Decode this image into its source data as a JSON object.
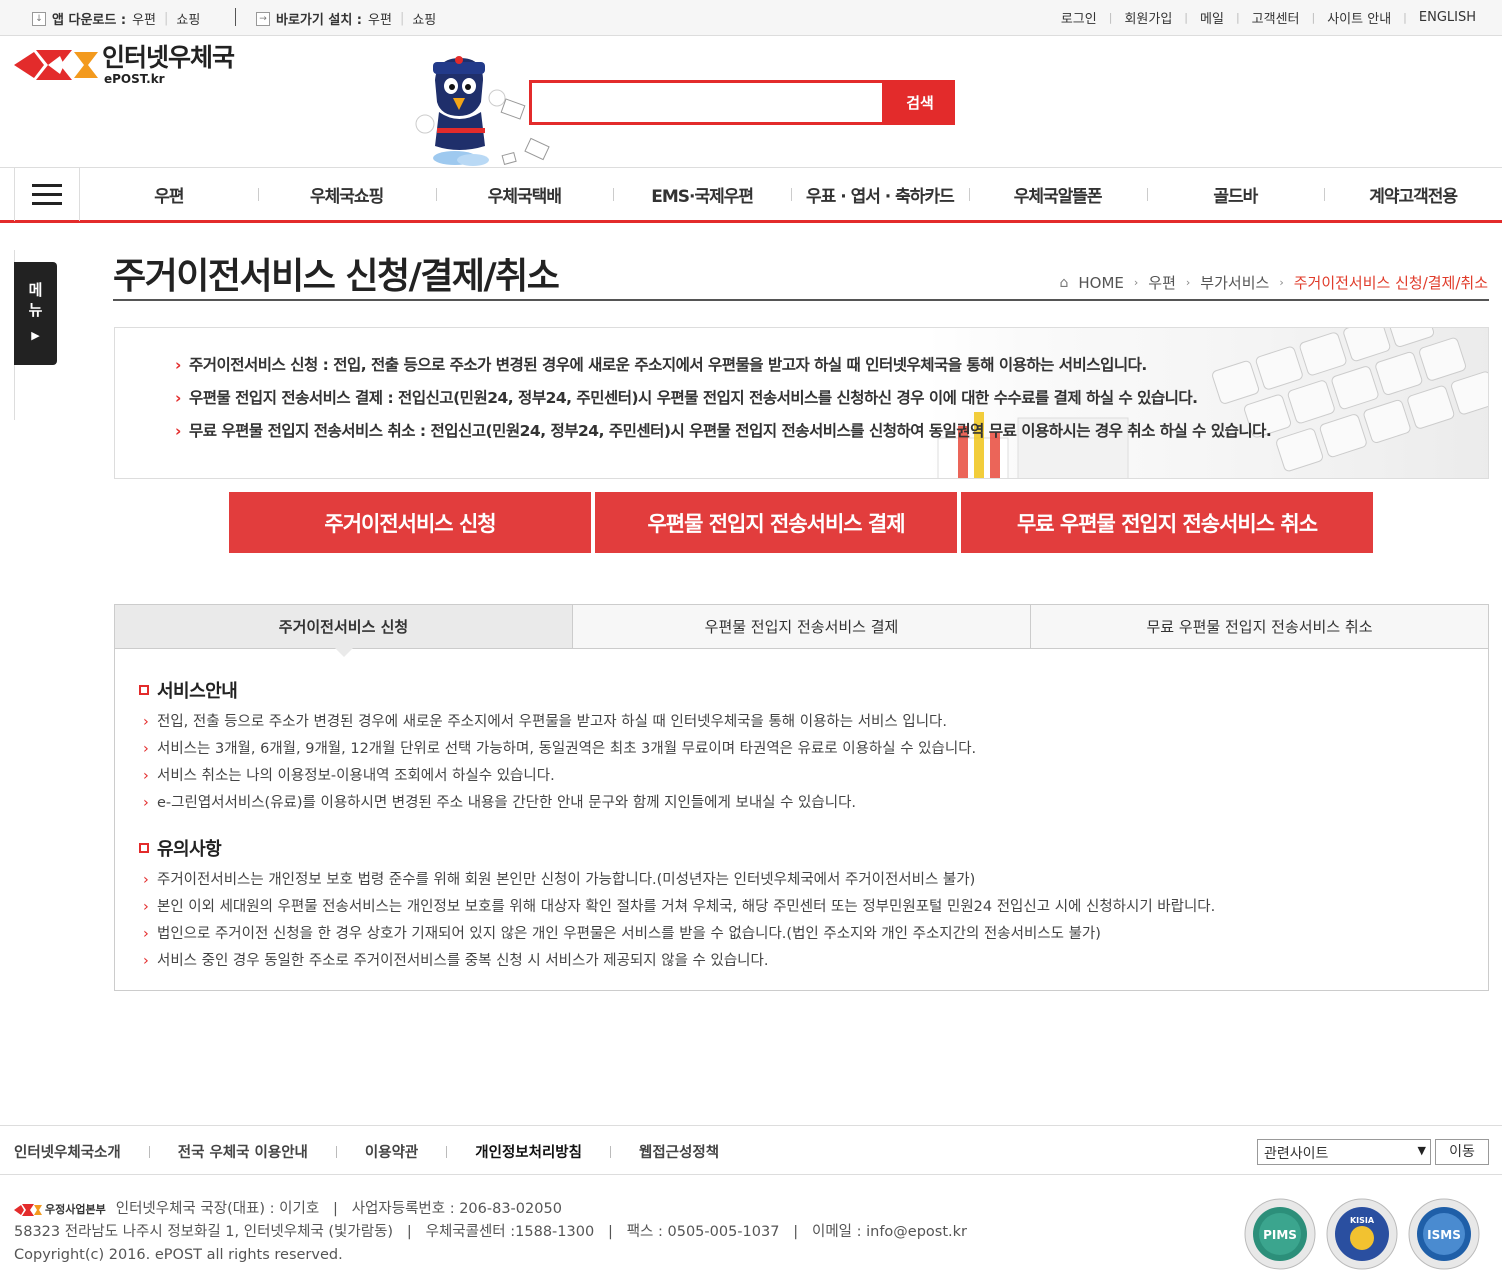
{
  "topbar": {
    "app_download_label": "앱 다운로드 :",
    "app_links": [
      "우편",
      "쇼핑"
    ],
    "shortcut_label": "바로가기 설치 :",
    "shortcut_links": [
      "우편",
      "쇼핑"
    ],
    "right_links": [
      "로그인",
      "회원가입",
      "메일",
      "고객센터",
      "사이트 안내",
      "ENGLISH"
    ]
  },
  "header": {
    "logo_korean": "인터넷우체국",
    "logo_english": "ePOST.kr",
    "search_placeholder": "",
    "search_button": "검색"
  },
  "gnb": {
    "items": [
      "우편",
      "우체국쇼핑",
      "우체국택배",
      "EMS·국제우편",
      "우표 · 엽서 · 축하카드",
      "우체국알뜰폰",
      "골드바",
      "계약고객전용"
    ]
  },
  "side_menu": {
    "label": "메뉴"
  },
  "page": {
    "title": "주거이전서비스 신청/결제/취소",
    "breadcrumb": [
      "HOME",
      "우편",
      "부가서비스",
      "주거이전서비스 신청/결제/취소"
    ]
  },
  "intro": {
    "items": [
      "주거이전서비스 신청 : 전입, 전출 등으로 주소가 변경된 경우에 새로운 주소지에서 우편물을 받고자 하실 때 인터넷우체국을 통해 이용하는 서비스입니다.",
      "우편물 전입지 전송서비스 결제 : 전입신고(민원24, 정부24, 주민센터)시 우편물 전입지 전송서비스를 신청하신 경우 이에 대한 수수료를 결제 하실 수 있습니다.",
      "무료 우편물 전입지 전송서비스 취소 : 전입신고(민원24, 정부24, 주민센터)시 우편물 전입지 전송서비스를 신청하여 동일권역 무료 이용하시는 경우 취소 하실 수 있습니다."
    ]
  },
  "big_buttons": [
    "주거이전서비스 신청",
    "우편물 전입지 전송서비스 결제",
    "무료 우편물 전입지 전송서비스 취소"
  ],
  "tabs": [
    "주거이전서비스 신청",
    "우편물 전입지 전송서비스 결제",
    "무료 우편물 전입지 전송서비스 취소"
  ],
  "service_guide": {
    "heading": "서비스안내",
    "items": [
      "전입, 전출 등으로 주소가 변경된 경우에 새로운 주소지에서 우편물을 받고자 하실 때 인터넷우체국을 통해 이용하는 서비스 입니다.",
      "서비스는 3개월, 6개월, 9개월, 12개월 단위로 선택 가능하며, 동일권역은 최초 3개월 무료이며 타권역은 유료로 이용하실 수 있습니다.",
      "서비스 취소는 나의 이용정보-이용내역 조회에서 하실수 있습니다.",
      "e-그린엽서서비스(유료)를 이용하시면 변경된 주소 내용을 간단한 안내 문구와 함께 지인들에게 보내실 수 있습니다."
    ]
  },
  "notes": {
    "heading": "유의사항",
    "items": [
      "주거이전서비스는 개인정보 보호 법령 준수를 위해 회원 본인만 신청이 가능합니다.(미성년자는 인터넷우체국에서 주거이전서비스 불가)",
      "본인 이외 세대원의 우편물 전송서비스는 개인정보 보호를 위해 대상자 확인 절차를 거쳐 우체국, 해당 주민센터 또는 정부민원포털 민원24 전입신고 시에 신청하시기 바랍니다.",
      "법인으로 주거이전 신청을 한 경우 상호가 기재되어 있지 않은 개인 우편물은 서비스를 받을 수 없습니다.(법인 주소지와 개인 주소지간의 전송서비스도 불가)",
      "서비스 중인 경우 동일한 주소로 주거이전서비스를 중복 신청 시 서비스가 제공되지 않을 수 있습니다."
    ]
  },
  "footer": {
    "links": [
      "인터넷우체국소개",
      "전국 우체국 이용안내",
      "이용약관",
      "개인정보처리방침",
      "웹접근성정책"
    ],
    "related_select": "관련사이트",
    "go_button": "이동",
    "org_name": "우정사업본부",
    "line1": "인터넷우체국 국장(대표) : 이기호   |   사업자등록번호 : 206-83-02050",
    "line2": "58323 전라남도 나주시 정보화길 1, 인터넷우체국 (빛가람동)   |   우체국콜센터 :1588-1300   |   팩스 : 0505-005-1037   |   이메일 : info@epost.kr",
    "copyright": "Copyright(c) 2016. ePOST all rights reserved.",
    "badges": [
      "PIMS",
      "KISIA",
      "ISMS"
    ]
  },
  "colors": {
    "accent": "#e32b2b",
    "button": "#e23d3d",
    "breadcrumb_current": "#e03c2b"
  }
}
